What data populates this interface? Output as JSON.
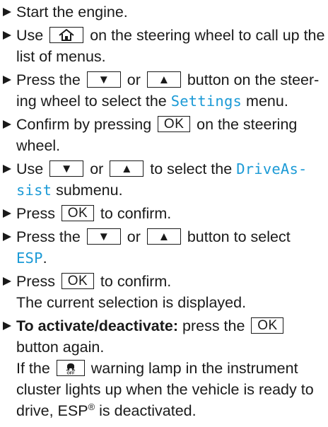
{
  "steps": [
    {
      "text": "Start the engine."
    },
    {
      "pre": "Use ",
      "post": " on the steering wheel to call up the list of menus."
    },
    {
      "pre": "Press the ",
      "or": " or ",
      "mid": " button on the steer-ing wheel to select the ",
      "highlight": "Settings",
      "post": " menu."
    },
    {
      "pre": "Confirm by pressing ",
      "post": " on the steering wheel."
    },
    {
      "pre": "Use ",
      "or": " or ",
      "mid": " to select the ",
      "highlight": "DriveAs-sist",
      "post": " submenu."
    },
    {
      "pre": "Press ",
      "post": " to confirm."
    },
    {
      "pre": "Press the ",
      "or": " or ",
      "mid": " button to select ",
      "highlight": "ESP",
      "post": "."
    },
    {
      "pre": "Press ",
      "post": " to confirm.",
      "note": "The current selection is displayed."
    },
    {
      "bold": "To activate/deactivate:",
      "pre": " press the ",
      "post": " button again.",
      "note_pre": "If the ",
      "note_post": " warning lamp in the instrument cluster lights up when the vehicle is ready to drive, ESP",
      "note_reg": "®",
      "note_end": " is deactivated."
    }
  ],
  "keys": {
    "down": "▼",
    "up": "▲",
    "ok": "OK"
  },
  "icons": {
    "home": "home-icon",
    "esp_off": "esp-off-icon"
  },
  "colors": {
    "highlight": "#1b9ad6",
    "text": "#1a1a1a"
  }
}
